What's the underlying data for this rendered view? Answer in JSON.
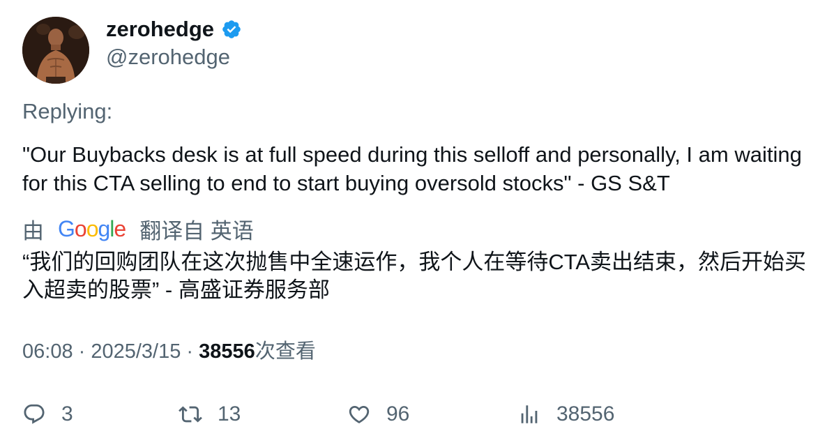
{
  "author": {
    "display_name": "zerohedge",
    "handle": "@zerohedge",
    "verified_color": "#1d9bf0"
  },
  "replying_label": "Replying:",
  "tweet": {
    "text": "\"Our Buybacks desk is at full speed during this selloff and personally, I am waiting for this CTA selling to end to start buying oversold stocks\" - GS S&T"
  },
  "translation": {
    "prefix": "由",
    "provider": "Google",
    "suffix": "翻译自 英语",
    "text": "“我们的回购团队在这次抛售中全速运作，我个人在等待CTA卖出结束，然后开始买入超卖的股票” - 高盛证券服务部"
  },
  "meta": {
    "time": "06:08",
    "sep1": " · ",
    "date": "2025/3/15",
    "sep2": " · ",
    "views": "38556",
    "views_label": "次查看"
  },
  "actions": {
    "replies": "3",
    "retweets": "13",
    "likes": "96",
    "views": "38556"
  },
  "colors": {
    "text": "#0f1419",
    "secondary": "#536471",
    "google_blue": "#4285F4",
    "google_red": "#EA4335",
    "google_yellow": "#FBBC05",
    "google_green": "#34A853"
  }
}
